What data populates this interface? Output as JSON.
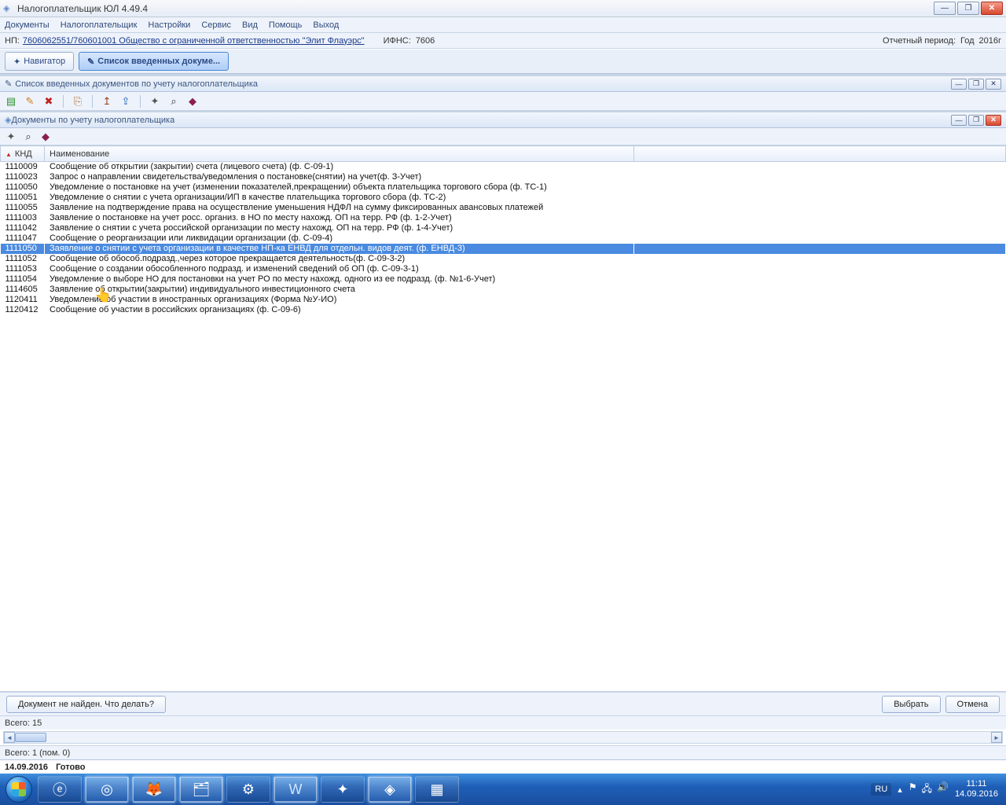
{
  "app": {
    "title": "Налогоплательщик ЮЛ 4.49.4"
  },
  "menu": [
    "Документы",
    "Налогоплательщик",
    "Настройки",
    "Сервис",
    "Вид",
    "Помощь",
    "Выход"
  ],
  "info": {
    "np_label": "НП:",
    "np_value": "7606062551/760601001 Общество с ограниченной ответственностью \"Элит Флауэрс\"",
    "ifns_label": "ИФНС:",
    "ifns_value": "7606",
    "period_label": "Отчетный период:",
    "year_label": "Год",
    "year_value": "2016г"
  },
  "nav": {
    "navigator": "Навигатор",
    "list_docs": "Список введенных докуме..."
  },
  "sub1": {
    "title": "Список введенных документов по учету налогоплательщика"
  },
  "sub2": {
    "title": "Документы по учету налогоплательщика",
    "col_knd": "КНД",
    "col_name": "Наименование",
    "rows": [
      {
        "knd": "1110009",
        "name": "Сообщение об открытии (закрытии) счета (лицевого счета) (ф. С-09-1)"
      },
      {
        "knd": "1110023",
        "name": "Запрос о направлении свидетельства/уведомления о постановке(снятии) на учет(ф. З-Учет)"
      },
      {
        "knd": "1110050",
        "name": "Уведомление о постановке на учет (изменении показателей,прекращении) объекта плательщика торгового сбора (ф. ТС-1)"
      },
      {
        "knd": "1110051",
        "name": "Уведомление о снятии с учета организации/ИП в качестве плательщика торгового сбора (ф. ТС-2)"
      },
      {
        "knd": "1110055",
        "name": "Заявление на подтверждение права на осуществление уменьшения НДФЛ на сумму фиксированных авансовых платежей"
      },
      {
        "knd": "1111003",
        "name": "Заявление о постановке на учет росс. организ. в НО по месту нахожд. ОП на терр. РФ (ф. 1-2-Учет)"
      },
      {
        "knd": "1111042",
        "name": "Заявление о снятии с учета  российской организации по месту нахожд. ОП на терр. РФ (ф. 1-4-Учет)"
      },
      {
        "knd": "1111047",
        "name": "Сообщение о реорганизации или ликвидации организации (ф. С-09-4)"
      },
      {
        "knd": "1111050",
        "name": "Заявление о снятии с учета организации в качестве НП-ка ЕНВД для отдельн. видов деят. (ф. ЕНВД-3)",
        "selected": true
      },
      {
        "knd": "1111052",
        "name": "Сообщение об обособ.подразд.,через которое прекращается деятельность(ф. С-09-3-2)"
      },
      {
        "knd": "1111053",
        "name": "Сообщение о создании обособленного подразд. и изменений сведений об ОП (ф. С-09-3-1)"
      },
      {
        "knd": "1111054",
        "name": "Уведомление о выборе НО для постановки на учет РО по месту нахожд. одного из ее подразд. (ф. №1-6-Учет)"
      },
      {
        "knd": "1114605",
        "name": "Заявление об открытии(закрытии) индивидуального инвестиционного счета"
      },
      {
        "knd": "1120411",
        "name": "Уведомление об участии в иностранных организациях (Форма №У-ИО)"
      },
      {
        "knd": "1120412",
        "name": "Сообщение  об участии в российских организациях (ф. С-09-6)"
      }
    ],
    "not_found": "Документ не найден. Что делать?",
    "select": "Выбрать",
    "cancel": "Отмена",
    "total": "Всего: 15"
  },
  "outer_total": "Всего: 1 (пом. 0)",
  "status": {
    "date": "14.09.2016",
    "ready": "Готово"
  },
  "taskbar": {
    "lang": "RU",
    "time": "11:11",
    "date": "14.09.2016"
  }
}
